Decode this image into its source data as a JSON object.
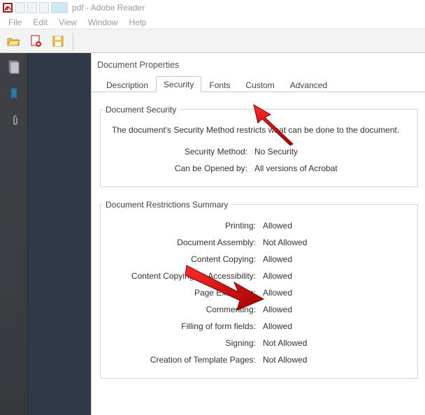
{
  "titlebar": {
    "title": "pdf - Adobe Reader"
  },
  "menubar": {
    "items": [
      "File",
      "Edit",
      "View",
      "Window",
      "Help"
    ]
  },
  "dialog": {
    "title": "Document Properties",
    "tabs": [
      "Description",
      "Security",
      "Fonts",
      "Custom",
      "Advanced"
    ],
    "active_tab_index": 1,
    "security": {
      "group_label": "Document Security",
      "intro": "The document's Security Method restricts what can be done to the document.",
      "method_label": "Security Method:",
      "method_value": "No Security",
      "opened_label": "Can be Opened by:",
      "opened_value": "All versions of Acrobat"
    },
    "restrictions": {
      "group_label": "Document Restrictions Summary",
      "rows": [
        {
          "label": "Printing:",
          "value": "Allowed"
        },
        {
          "label": "Document Assembly:",
          "value": "Not Allowed"
        },
        {
          "label": "Content Copying:",
          "value": "Allowed"
        },
        {
          "label": "Content Copying for Accessibility:",
          "value": "Allowed"
        },
        {
          "label": "Page Extraction:",
          "value": "Allowed"
        },
        {
          "label": "Commenting:",
          "value": "Allowed"
        },
        {
          "label": "Filling of form fields:",
          "value": "Allowed"
        },
        {
          "label": "Signing:",
          "value": "Not Allowed"
        },
        {
          "label": "Creation of Template Pages:",
          "value": "Not Allowed"
        }
      ]
    }
  }
}
